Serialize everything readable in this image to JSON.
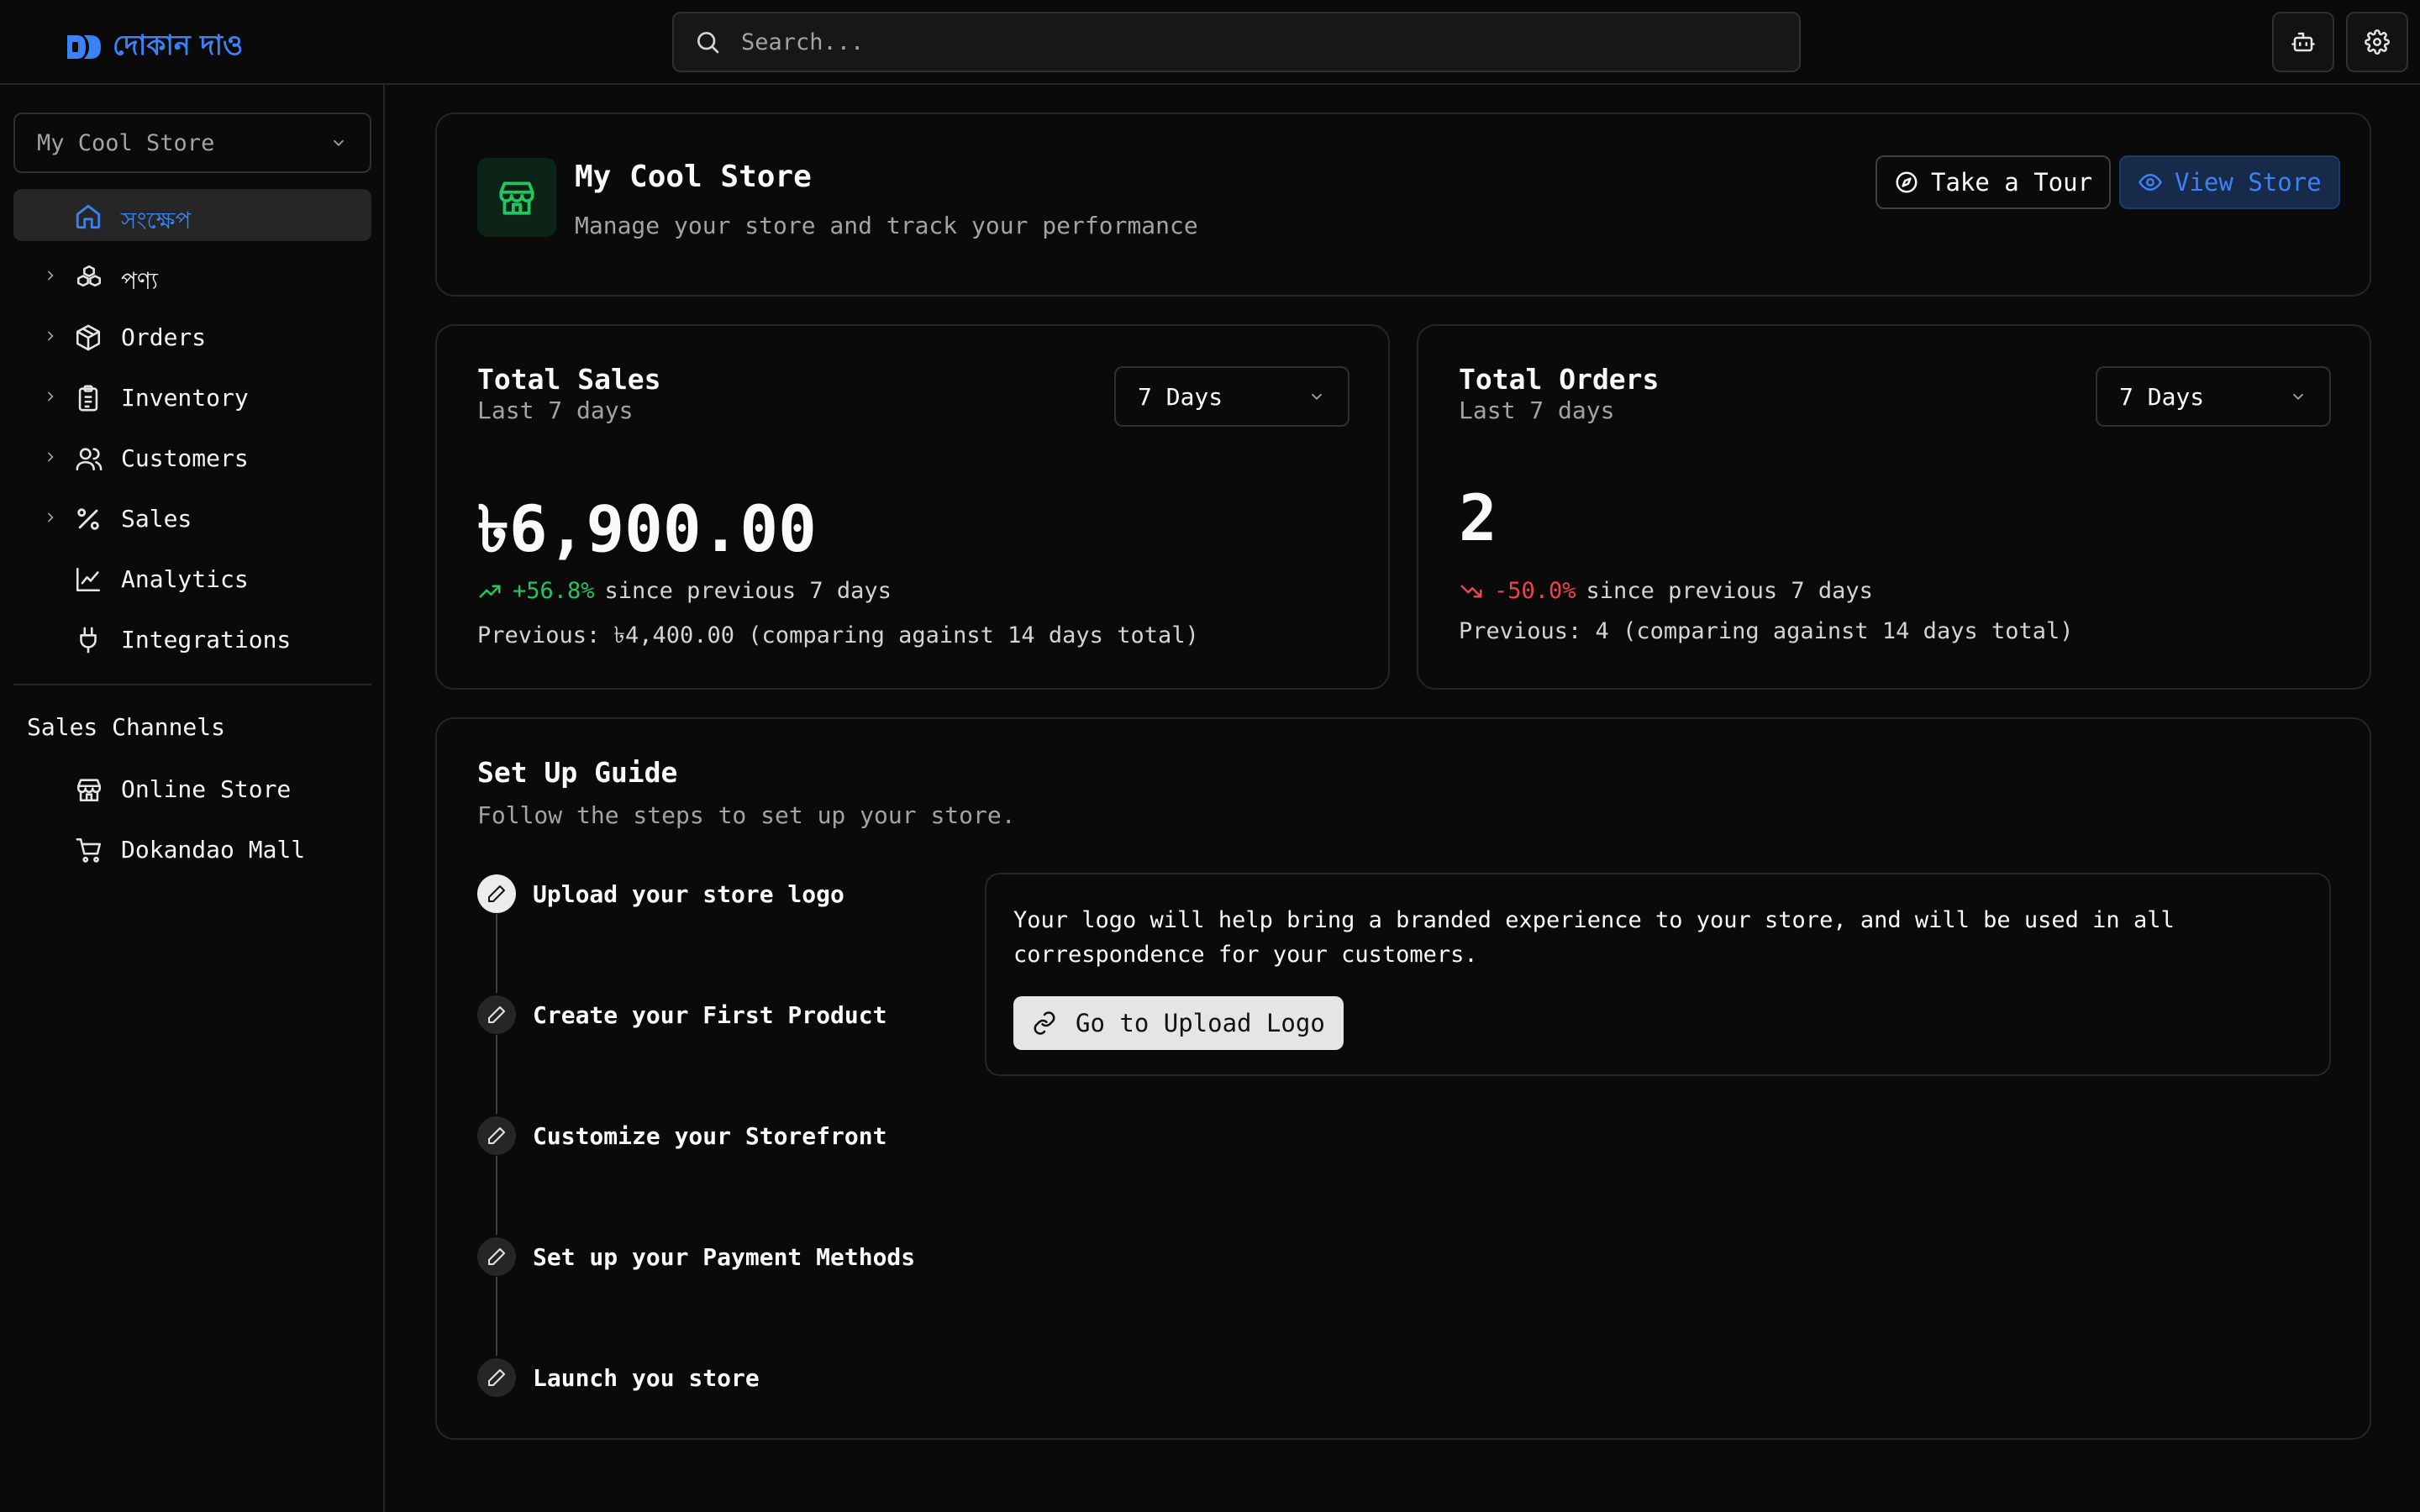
{
  "brand": {
    "name": "দোকান দাও",
    "accent": "#3b82f6"
  },
  "search": {
    "placeholder": "Search..."
  },
  "sidebar": {
    "store_selector": "My Cool Store",
    "items": [
      {
        "label": "সংক্ষেপ",
        "icon": "home-icon",
        "active": true
      },
      {
        "label": "পণ্য",
        "icon": "boxes-icon"
      },
      {
        "label": "Orders",
        "icon": "package-icon"
      },
      {
        "label": "Inventory",
        "icon": "clipboard-icon"
      },
      {
        "label": "Customers",
        "icon": "users-icon"
      },
      {
        "label": "Sales",
        "icon": "percent-icon"
      },
      {
        "label": "Analytics",
        "icon": "chart-line-icon"
      },
      {
        "label": "Integrations",
        "icon": "plug-icon"
      }
    ],
    "channels_title": "Sales Channels",
    "channels": [
      {
        "label": "Online Store",
        "icon": "store-icon"
      },
      {
        "label": "Dokandao Mall",
        "icon": "cart-icon"
      }
    ]
  },
  "header": {
    "title": "My Cool Store",
    "subtitle": "Manage your store and track your performance",
    "tour_label": "Take a Tour",
    "view_label": "View Store"
  },
  "sales": {
    "title": "Total Sales",
    "subtitle": "Last 7 days",
    "period": "7 Days",
    "value": "৳6,900.00",
    "change": "+56.8%",
    "since": "since previous 7 days",
    "previous": "Previous: ৳4,400.00 (comparing against 14 days total)",
    "positive_color": "#22c55e"
  },
  "orders": {
    "title": "Total Orders",
    "subtitle": "Last 7 days",
    "period": "7 Days",
    "value": "2",
    "change": "-50.0%",
    "since": "since previous 7 days",
    "previous": "Previous: 4 (comparing against 14 days total)",
    "negative_color": "#ef4444"
  },
  "guide": {
    "title": "Set Up Guide",
    "subtitle": "Follow the steps to set up your store.",
    "steps": [
      "Upload your store logo",
      "Create your First Product",
      "Customize your Storefront",
      "Set up your Payment Methods",
      "Launch you store"
    ],
    "detail_text": "Your logo will help bring a branded experience to your store, and will be used in all correspondence for your customers.",
    "detail_button": "Go to Upload Logo"
  }
}
